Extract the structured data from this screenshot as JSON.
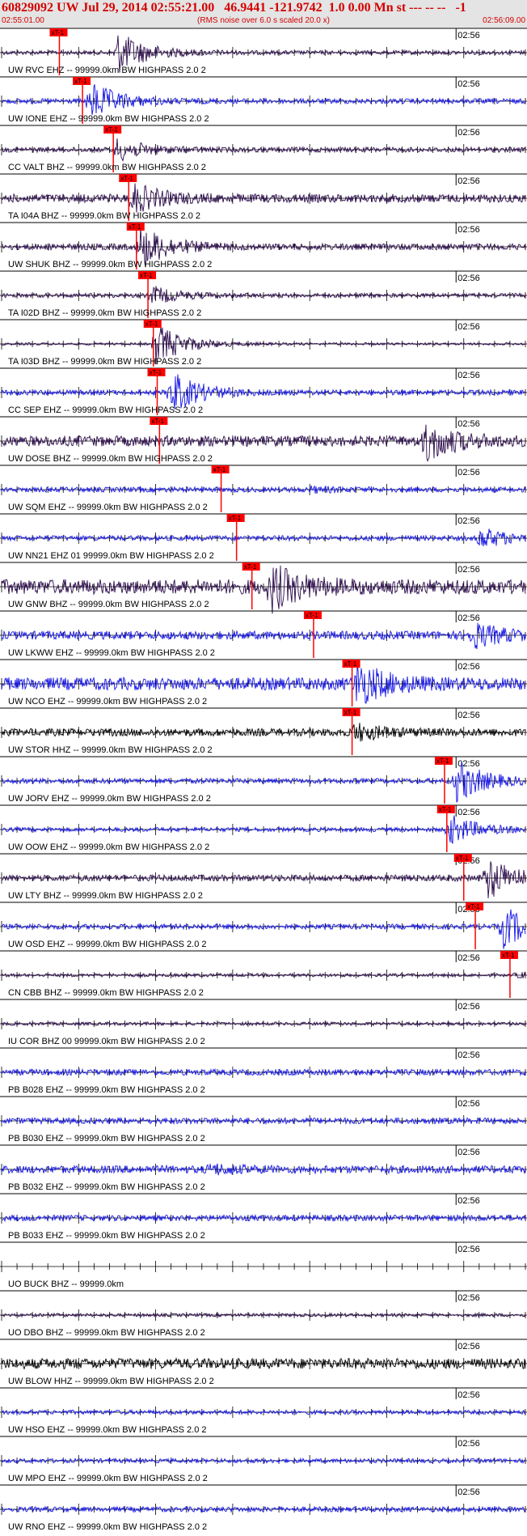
{
  "header": {
    "title": "60829092 UW Jul 29, 2014 02:55:21.00   46.9441 -121.9742  1.0 0.00 Mn st --- -- --   -1",
    "start_time": "02:55:01.00",
    "note": "(RMS noise over 6.0 s scaled 20.0 x)",
    "end_time": "02:56:09.00"
  },
  "colors": {
    "header_text": "#d40000",
    "blue_trace": "#1414e6",
    "dark_trace": "#2a0a4a",
    "black_trace": "#000000",
    "pick": "#ff0000",
    "axis": "#000000"
  },
  "pick_label": "xT-1",
  "chart_data": {
    "type": "line",
    "title": "60829092 UW Jul 29, 2014 02:55:21.00   46.9441 -121.9742  1.0 0.00 Mn st --- -- --   -1",
    "xlabel": "",
    "ylabel": "",
    "x_start": "02:55:01.00",
    "x_end": "02:56:09.00",
    "xlim_seconds": [
      0,
      68
    ],
    "tick_label": "02:56",
    "series": [
      {
        "name": "UW RVC EHZ -- 99999.0km BW HIGHPASS 2.0 2",
        "color": "dark",
        "pick_s": 7.5,
        "burst_s": 15,
        "burst_amp": 1.0,
        "noise": 0.1
      },
      {
        "name": "UW IONE EHZ -- 99999.0km BW HIGHPASS 2.0 2",
        "color": "blue",
        "pick_s": 10.5,
        "burst_s": 11.5,
        "burst_amp": 0.9,
        "noise": 0.12
      },
      {
        "name": "CC VALT BHZ -- 99999.0km BW HIGHPASS 2.0 2",
        "color": "dark",
        "pick_s": 14.5,
        "burst_s": 15,
        "burst_amp": 0.5,
        "noise": 0.12
      },
      {
        "name": "TA I04A BHZ -- 99999.0km BW HIGHPASS 2.0 2",
        "color": "dark",
        "pick_s": 16.5,
        "burst_s": 16.8,
        "burst_amp": 0.7,
        "noise": 0.2
      },
      {
        "name": "UW SHUK BHZ -- 99999.0km BW HIGHPASS 2.0 2",
        "color": "dark",
        "pick_s": 17.5,
        "burst_s": 18,
        "burst_amp": 1.0,
        "noise": 0.15
      },
      {
        "name": "TA I02D BHZ -- 99999.0km BW HIGHPASS 2.0 2",
        "color": "dark",
        "pick_s": 19.0,
        "burst_s": 19.5,
        "burst_amp": 0.4,
        "noise": 0.1
      },
      {
        "name": "TA I03D BHZ -- 99999.0km BW HIGHPASS 2.0 2",
        "color": "dark",
        "pick_s": 19.7,
        "burst_s": 20,
        "burst_amp": 1.0,
        "noise": 0.06
      },
      {
        "name": "CC SEP EHZ -- 99999.0km BW HIGHPASS 2.0 2",
        "color": "blue",
        "pick_s": 20.2,
        "burst_s": 22,
        "burst_amp": 1.0,
        "noise": 0.12
      },
      {
        "name": "UW DOSE BHZ -- 99999.0km BW HIGHPASS 2.0 2",
        "color": "dark",
        "pick_s": 20.5,
        "burst_s": 55,
        "burst_amp": 0.9,
        "noise": 0.25
      },
      {
        "name": "UW SQM EHZ -- 99999.0km BW HIGHPASS 2.0 2",
        "color": "blue",
        "pick_s": 28.5,
        "burst_s": 40,
        "burst_amp": 0.1,
        "noise": 0.12
      },
      {
        "name": "UW NN21 EHZ 01 99999.0km BW HIGHPASS 2.0 2",
        "color": "blue",
        "pick_s": 30.5,
        "burst_s": 62,
        "burst_amp": 0.5,
        "noise": 0.12
      },
      {
        "name": "UW GNW BHZ -- 99999.0km BW HIGHPASS 2.0 2",
        "color": "dark",
        "pick_s": 32.5,
        "burst_s": 35,
        "burst_amp": 1.0,
        "noise": 0.35
      },
      {
        "name": "UW LKWW EHZ -- 99999.0km BW HIGHPASS 2.0 2",
        "color": "blue",
        "pick_s": 40.5,
        "burst_s": 61,
        "burst_amp": 0.6,
        "noise": 0.2
      },
      {
        "name": "UW NCO EHZ -- 99999.0km BW HIGHPASS 2.0 2",
        "color": "blue",
        "pick_s": 45.5,
        "burst_s": 46,
        "burst_amp": 1.0,
        "noise": 0.3
      },
      {
        "name": "UW STOR HHZ -- 99999.0km BW HIGHPASS 2.0 2",
        "color": "black",
        "pick_s": 45.5,
        "burst_s": 45.7,
        "burst_amp": 0.4,
        "noise": 0.18
      },
      {
        "name": "UW JORV EHZ -- 99999.0km BW HIGHPASS 2.0 2",
        "color": "blue",
        "pick_s": 57.5,
        "burst_s": 59,
        "burst_amp": 1.0,
        "noise": 0.12
      },
      {
        "name": "UW OOW EHZ -- 99999.0km BW HIGHPASS 2.0 2",
        "color": "blue",
        "pick_s": 57.8,
        "burst_s": 58.1,
        "burst_amp": 0.7,
        "noise": 0.1
      },
      {
        "name": "UW LTY BHZ -- 99999.0km BW HIGHPASS 2.0 2",
        "color": "dark",
        "pick_s": 60.0,
        "burst_s": 63,
        "burst_amp": 1.0,
        "noise": 0.15
      },
      {
        "name": "UW OSD EHZ -- 99999.0km BW HIGHPASS 2.0 2",
        "color": "blue",
        "pick_s": 61.5,
        "burst_s": 65,
        "burst_amp": 1.0,
        "noise": 0.12
      },
      {
        "name": "CN CBB BHZ -- 99999.0km BW HIGHPASS 2.0 2",
        "color": "dark",
        "pick_s": 66.0,
        "burst_s": 67,
        "burst_amp": 0.1,
        "noise": 0.08
      },
      {
        "name": "IU COR BHZ 00 99999.0km BW HIGHPASS 2.0 2",
        "color": "dark",
        "pick_s": null,
        "burst_s": null,
        "burst_amp": 0,
        "noise": 0.08
      },
      {
        "name": "PB B028 EHZ -- 99999.0km BW HIGHPASS 2.0 2",
        "color": "blue",
        "pick_s": null,
        "burst_s": null,
        "burst_amp": 0,
        "noise": 0.14
      },
      {
        "name": "PB B030 EHZ -- 99999.0km BW HIGHPASS 2.0 2",
        "color": "blue",
        "pick_s": null,
        "burst_s": null,
        "burst_amp": 0,
        "noise": 0.14
      },
      {
        "name": "PB B032 EHZ -- 99999.0km BW HIGHPASS 2.0 2",
        "color": "blue",
        "pick_s": null,
        "burst_s": 27,
        "burst_amp": 0.2,
        "noise": 0.18
      },
      {
        "name": "PB B033 EHZ -- 99999.0km BW HIGHPASS 2.0 2",
        "color": "blue",
        "pick_s": null,
        "burst_s": null,
        "burst_amp": 0,
        "noise": 0.14
      },
      {
        "name": "UO BUCK BHZ -- 99999.0km",
        "color": "none",
        "pick_s": null,
        "burst_s": null,
        "burst_amp": 0,
        "noise": 0
      },
      {
        "name": "UO DBO BHZ -- 99999.0km BW HIGHPASS 2.0 2",
        "color": "dark",
        "pick_s": null,
        "burst_s": null,
        "burst_amp": 0,
        "noise": 0.08
      },
      {
        "name": "UW BLOW HHZ -- 99999.0km BW HIGHPASS 2.0 2",
        "color": "black",
        "pick_s": null,
        "burst_s": null,
        "burst_amp": 0,
        "noise": 0.25
      },
      {
        "name": "UW HSO EHZ -- 99999.0km BW HIGHPASS 2.0 2",
        "color": "blue",
        "pick_s": null,
        "burst_s": null,
        "burst_amp": 0,
        "noise": 0.1
      },
      {
        "name": "UW MPO EHZ -- 99999.0km BW HIGHPASS 2.0 2",
        "color": "blue",
        "pick_s": null,
        "burst_s": null,
        "burst_amp": 0,
        "noise": 0.1
      },
      {
        "name": "UW RNO EHZ -- 99999.0km BW HIGHPASS 2.0 2",
        "color": "blue",
        "pick_s": null,
        "burst_s": null,
        "burst_amp": 0,
        "noise": 0.12
      }
    ]
  }
}
